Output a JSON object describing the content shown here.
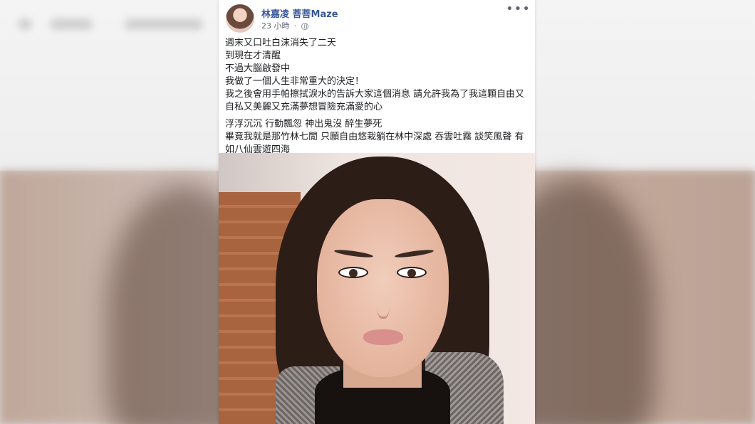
{
  "post": {
    "author": "林嘉凌 菩菩Maze",
    "time": "23 小時",
    "separator": "·",
    "audience_icon": "globe-icon",
    "more_icon": "more-options-icon",
    "paragraph1": [
      "週末又口吐白沫消失了二天",
      "到現在才清醒",
      "不過大腦啟發中",
      "我做了一個人生非常重大的決定！",
      "我之後會用手帕擦拭淚水的告訴大家這個消息 請允許我為了我這顆自由又自私又美麗又充滿夢想冒險充滿愛的心"
    ],
    "paragraph2": [
      "浮浮沉沉 行動飄忽 神出鬼沒 醉生夢死",
      "畢竟我就是那竹林七閒 只願自由悠栽躺在林中深處 吞雲吐霧 談笑風聲 有如八仙雲遊四海"
    ]
  },
  "colors": {
    "author_link": "#385898",
    "meta_text": "#616770",
    "body_text": "#1c1e21",
    "card_bg": "#ffffff"
  }
}
